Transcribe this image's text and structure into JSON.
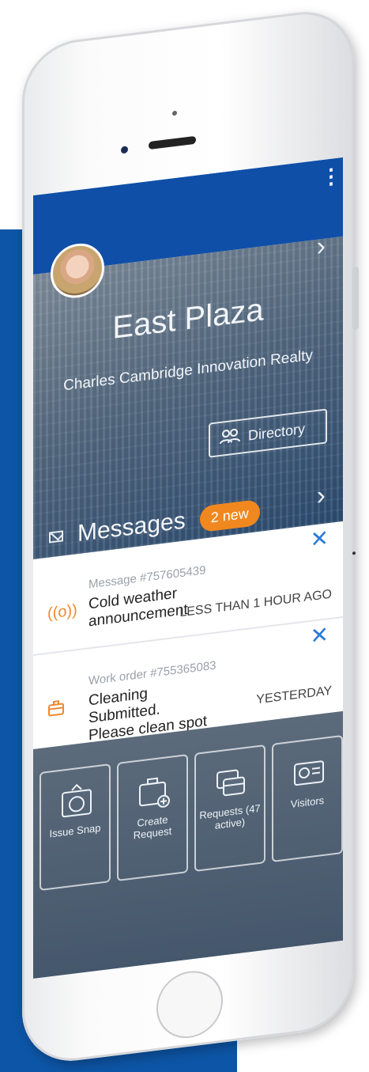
{
  "app": {
    "building": "East Plaza",
    "company": "Charles Cambridge Innovation Realty",
    "directory_label": "Directory"
  },
  "messages": {
    "label": "Messages",
    "badge": "2 new",
    "items": [
      {
        "ref": "Message #757605439",
        "text": "Cold weather announcement",
        "time": "LESS THAN 1 HOUR AGO",
        "icon": "broadcast-icon"
      },
      {
        "ref": "Work order #755365083",
        "text": "Cleaning Submitted. Please clean spot on",
        "time": "YESTERDAY",
        "icon": "briefcase-icon"
      }
    ]
  },
  "actions": [
    {
      "label": "Issue Snap",
      "icon": "camera-icon"
    },
    {
      "label": "Create Request",
      "icon": "briefcase-add-icon"
    },
    {
      "label": "Requests (47 active)",
      "icon": "briefcases-icon"
    },
    {
      "label": "Visitors",
      "icon": "id-card-icon"
    }
  ],
  "colors": {
    "brand_blue": "#0f4fa8",
    "accent_orange": "#f0881f",
    "close_blue": "#2d7ad8"
  }
}
